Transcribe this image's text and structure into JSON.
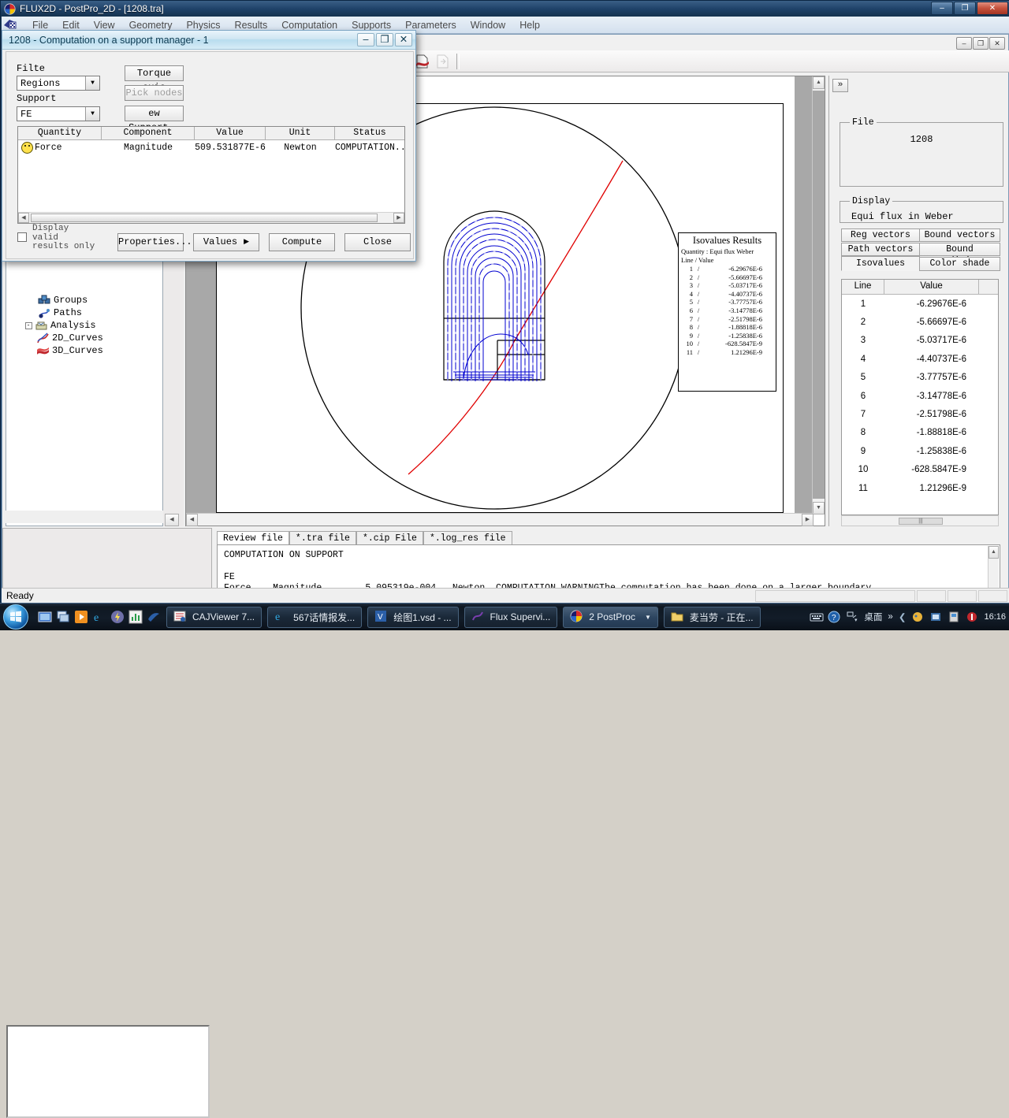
{
  "window": {
    "title": "FLUX2D - PostPro_2D - [1208.tra]",
    "icon": "flux-app-icon",
    "minimize": "–",
    "maximize": "❐",
    "close": "✕"
  },
  "menu": {
    "items": [
      {
        "label": "File"
      },
      {
        "label": "Edit"
      },
      {
        "label": "View"
      },
      {
        "label": "Geometry"
      },
      {
        "label": "Physics"
      },
      {
        "label": "Results"
      },
      {
        "label": "Computation"
      },
      {
        "label": "Supports"
      },
      {
        "label": "Parameters"
      },
      {
        "label": "Window"
      },
      {
        "label": "Help"
      }
    ]
  },
  "child_window": {
    "minimize": "–",
    "maximize": "❐",
    "close": "✕"
  },
  "toolbar": {
    "buttons": [
      {
        "name": "mesh-paint-icon"
      },
      {
        "name": "isolines-icon"
      },
      {
        "name": "isolines-edit-icon"
      },
      {
        "name": "curve-2d-icon"
      },
      {
        "name": "histogram-icon"
      },
      {
        "name": "surface-3d-icon"
      },
      {
        "name": "new-file-icon"
      },
      {
        "name": "curve-file-icon"
      },
      {
        "name": "surface-file-icon"
      },
      {
        "name": "export-icon"
      }
    ]
  },
  "tree": {
    "items": [
      {
        "label": "Groups",
        "icon": "groups-icon",
        "indent": 2,
        "expander": ""
      },
      {
        "label": "Paths",
        "icon": "paths-icon",
        "indent": 2,
        "expander": ""
      },
      {
        "label": "Analysis",
        "icon": "analysis-icon",
        "indent": 1,
        "expander": "-"
      },
      {
        "label": "2D_Curves",
        "icon": "curve-2d-icon",
        "indent": 2,
        "expander": ""
      },
      {
        "label": "3D_Curves",
        "icon": "curve-3d-icon",
        "indent": 2,
        "expander": ""
      }
    ]
  },
  "right_panel": {
    "expand_label": "»",
    "file_group": {
      "legend": "File",
      "value": "1208"
    },
    "display_group": {
      "legend": "Display",
      "value": "Equi flux in Weber"
    },
    "buttons": [
      {
        "label": "Reg vectors"
      },
      {
        "label": "Bound vectors"
      },
      {
        "label": "Path vectors"
      },
      {
        "label": "Bound conditions"
      },
      {
        "label": "Isovalues"
      },
      {
        "label": "Color shade"
      }
    ],
    "table": {
      "headers": [
        "Line",
        "Value"
      ],
      "rows": [
        {
          "line": "1",
          "value": "-6.29676E-6"
        },
        {
          "line": "2",
          "value": "-5.66697E-6"
        },
        {
          "line": "3",
          "value": "-5.03717E-6"
        },
        {
          "line": "4",
          "value": "-4.40737E-6"
        },
        {
          "line": "5",
          "value": "-3.77757E-6"
        },
        {
          "line": "6",
          "value": "-3.14778E-6"
        },
        {
          "line": "7",
          "value": "-2.51798E-6"
        },
        {
          "line": "8",
          "value": "-1.88818E-6"
        },
        {
          "line": "9",
          "value": "-1.25838E-6"
        },
        {
          "line": "10",
          "value": "-628.5847E-9"
        },
        {
          "line": "11",
          "value": "1.21296E-9"
        }
      ]
    }
  },
  "isovalues_legend": {
    "title": "Isovalues Results",
    "quantity": "Quantity : Equi flux Weber",
    "column_header": "Line / Value",
    "rows": [
      {
        "line": "1",
        "sep": "/",
        "value": "-6.29676E-6"
      },
      {
        "line": "2",
        "sep": "/",
        "value": "-5.66697E-6"
      },
      {
        "line": "3",
        "sep": "/",
        "value": "-5.03717E-6"
      },
      {
        "line": "4",
        "sep": "/",
        "value": "-4.40737E-6"
      },
      {
        "line": "5",
        "sep": "/",
        "value": "-3.77757E-6"
      },
      {
        "line": "6",
        "sep": "/",
        "value": "-3.14778E-6"
      },
      {
        "line": "7",
        "sep": "/",
        "value": "-2.51798E-6"
      },
      {
        "line": "8",
        "sep": "/",
        "value": "-1.88818E-6"
      },
      {
        "line": "9",
        "sep": "/",
        "value": "-1.25838E-6"
      },
      {
        "line": "10",
        "sep": "/",
        "value": "-628.5847E-9"
      },
      {
        "line": "11",
        "sep": "/",
        "value": "1.21296E-9"
      }
    ]
  },
  "dialog": {
    "title": "1208 - Computation on a support manager - 1",
    "minimize": "–",
    "maximize": "❐",
    "close": "✕",
    "filter_label": "Filtе",
    "filter_value": "Regions",
    "support_label": "Support",
    "support_value": "FE",
    "buttons_right": [
      {
        "label": "Torque axis",
        "disabled": false
      },
      {
        "label": "Pick nodes",
        "disabled": true
      },
      {
        "label": "ew Support..",
        "disabled": false
      }
    ],
    "grid": {
      "headers": [
        "Quantity",
        "Component",
        "Value",
        "Unit",
        "Status"
      ],
      "rows": [
        {
          "quantity": "Force",
          "component": "Magnitude",
          "value": "509.531877E-6",
          "unit": "Newton",
          "status": "COMPUTATION.."
        }
      ]
    },
    "checkbox_label": "Display valid results only",
    "checkbox_l1": "Display",
    "checkbox_l2": "valid",
    "checkbox_l3": "results only",
    "footer_buttons": [
      {
        "label": "Properties..."
      },
      {
        "label": "Values"
      },
      {
        "label": "Compute"
      },
      {
        "label": "Close"
      }
    ],
    "values_arrow": "▶"
  },
  "output_panel": {
    "tabs": [
      {
        "label": "Review file",
        "active": true
      },
      {
        "label": "*.tra file",
        "active": false
      },
      {
        "label": "*.cip File",
        "active": false
      },
      {
        "label": "*.log_res file",
        "active": false
      }
    ],
    "text": "COMPUTATION ON SUPPORT\n\nFE\nForce    Magnitude        5.095319e-004   Newton  COMPUTATION WARNINGThe computation has been done on a larger boundary."
  },
  "status_bar": {
    "text": "Ready"
  },
  "taskbar": {
    "start": "start-orb",
    "quick_launch": [
      {
        "name": "show-desktop-icon"
      },
      {
        "name": "switch-window-icon"
      },
      {
        "name": "media-player-icon"
      },
      {
        "name": "internet-explorer-icon"
      },
      {
        "name": "winamp-icon"
      },
      {
        "name": "green-app-icon"
      },
      {
        "name": "blue-bird-icon"
      }
    ],
    "tasks": [
      {
        "label": "CAJViewer 7...",
        "icon": "cajviewer-icon"
      },
      {
        "label": "567话情报发...",
        "icon": "internet-explorer-icon"
      },
      {
        "label": "绘图1.vsd - ...",
        "icon": "visio-icon"
      },
      {
        "label": "Flux Supervi...",
        "icon": "flux-icon"
      },
      {
        "label": "2 PostProc",
        "icon": "flux-app-icon",
        "group": true,
        "arrow": "▼"
      },
      {
        "label": "麦当劳 - 正在...",
        "icon": "folder-icon"
      }
    ],
    "tray": [
      {
        "name": "keyboard-icon"
      },
      {
        "name": "help-icon"
      },
      {
        "name": "network-icon"
      },
      {
        "name": "desktop-label",
        "label": "桌面"
      },
      {
        "name": "overflow-chevron",
        "label": "»"
      }
    ],
    "clock": "16:16"
  }
}
